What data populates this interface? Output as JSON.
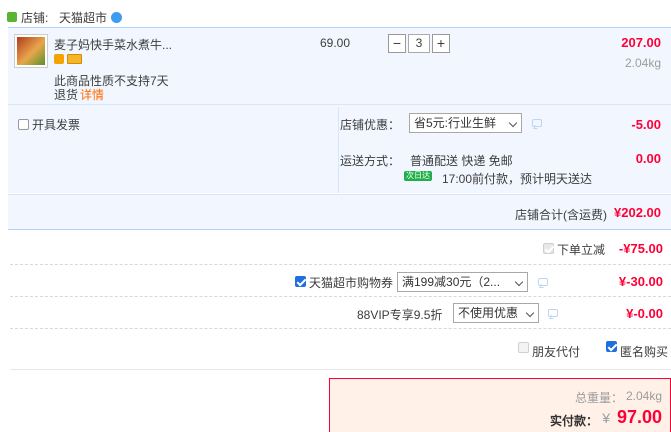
{
  "shop": {
    "label": "店铺:",
    "name": "天猫超市"
  },
  "item": {
    "title": "麦子妈快手菜水煮牛...",
    "unit_price": "69.00",
    "quantity": "3",
    "minus": "−",
    "plus": "+",
    "subtotal": "207.00",
    "weight": "2.04kg",
    "note_line1": "此商品性质不支持7天",
    "note_line2_prefix": "退货",
    "note_detail": "详情"
  },
  "invoice": {
    "label": "开具发票"
  },
  "shop_discount": {
    "label": "店铺优惠：",
    "selected": "省5元:行业生鲜",
    "amount": "-5.00"
  },
  "shipping": {
    "label": "运送方式：",
    "method": "普通配送 快递 免邮",
    "badge": "次日达",
    "eta": "17:00前付款，预计明天送达",
    "fee": "0.00"
  },
  "shop_total": {
    "label": "店铺合计(含运费)",
    "amount": "¥202.00"
  },
  "instant_discount": {
    "label": "下单立减",
    "amount": "-¥75.00"
  },
  "coupon": {
    "label": "天猫超市购物券",
    "selected": "满199减30元（2...",
    "amount": "¥-30.00"
  },
  "vip": {
    "label": "88VIP专享9.5折",
    "selected": "不使用优惠",
    "amount": "¥-0.00"
  },
  "options": {
    "friend_pay": "朋友代付",
    "anonymous": "匿名购买"
  },
  "summary": {
    "weight_label": "总重量：",
    "weight": "2.04kg",
    "pay_label": "实付款：",
    "currency": "¥",
    "pay_amount": "97.00"
  },
  "colors": {
    "accent_red": "#ff0036",
    "panel_blue": "#f2f7ff",
    "panel_border": "#b2d1ff"
  }
}
